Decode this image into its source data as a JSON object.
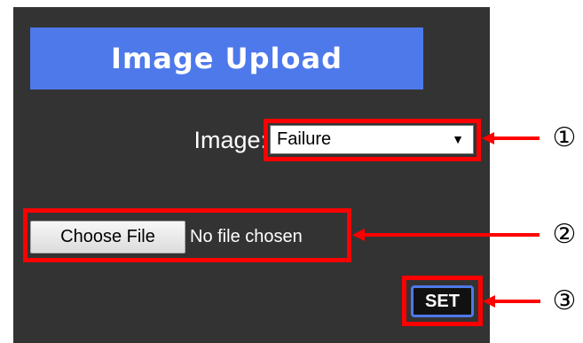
{
  "header": {
    "title": "Image Upload"
  },
  "image_field": {
    "label": "Image:",
    "selected_value": "Failure",
    "arrow_glyph": "▼"
  },
  "file_input": {
    "button_label": "Choose File",
    "status_text": "No file chosen"
  },
  "set_button": {
    "label": "SET"
  },
  "callouts": [
    {
      "number": "①"
    },
    {
      "number": "②"
    },
    {
      "number": "③"
    }
  ],
  "colors": {
    "panel_background": "#333333",
    "title_bar": "#4e79ea",
    "highlight": "#ff0000",
    "set_button_border": "#4e79ea"
  }
}
